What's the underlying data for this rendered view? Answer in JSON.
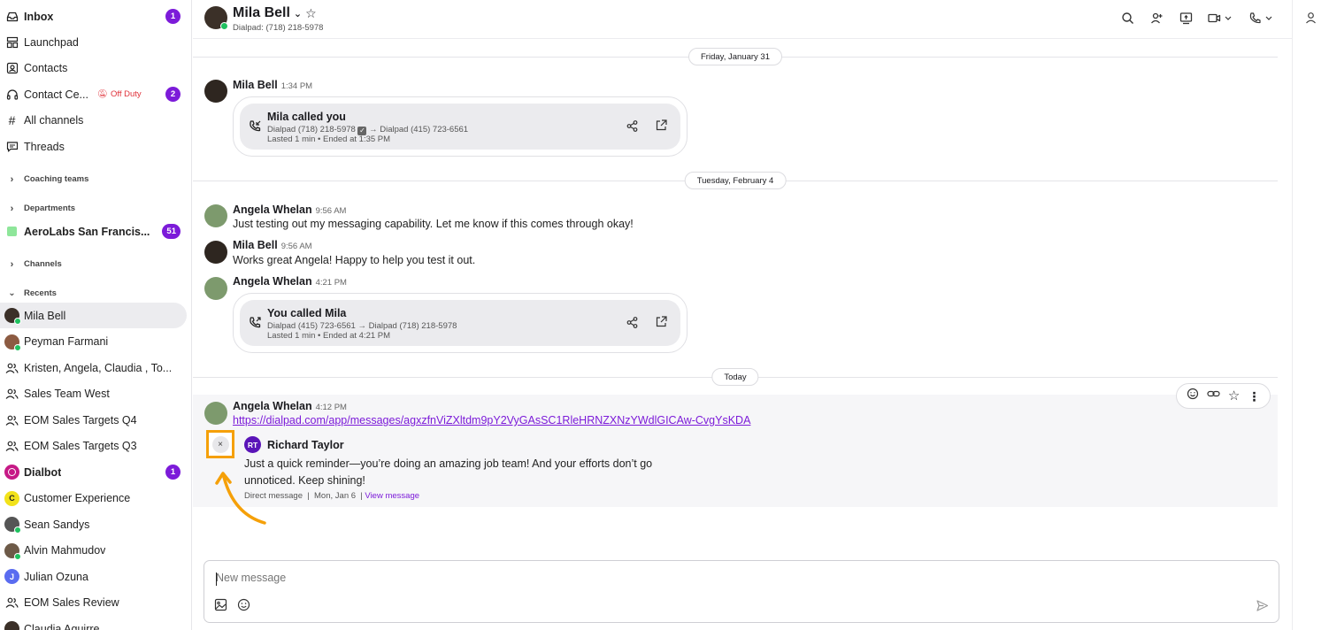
{
  "sidebar": {
    "inbox": {
      "label": "Inbox",
      "badge": "1"
    },
    "launchpad": "Launchpad",
    "contacts": "Contacts",
    "contact_center": {
      "label": "Contact Ce...",
      "status": "Off Duty",
      "badge": "2"
    },
    "all_channels": "All channels",
    "threads": "Threads",
    "coaching_teams": "Coaching teams",
    "departments": "Departments",
    "aerolabs": {
      "label": "AeroLabs San Francis...",
      "badge": "51"
    },
    "channels": "Channels",
    "recents": "Recents",
    "recent_items": [
      {
        "label": "Mila Bell",
        "type": "person",
        "online": true,
        "active": true
      },
      {
        "label": "Peyman Farmani",
        "type": "person",
        "online": true
      },
      {
        "label": "Kristen, Angela, Claudia , To...",
        "type": "group"
      },
      {
        "label": "Sales Team West",
        "type": "group"
      },
      {
        "label": "EOM Sales Targets Q4",
        "type": "group"
      },
      {
        "label": "EOM Sales Targets Q3",
        "type": "group"
      },
      {
        "label": "Dialbot",
        "type": "bot",
        "bold": true,
        "badge": "1"
      },
      {
        "label": "Customer Experience",
        "type": "letter",
        "letter": "C"
      },
      {
        "label": "Sean Sandys",
        "type": "person",
        "online": true
      },
      {
        "label": "Alvin Mahmudov",
        "type": "person",
        "online": true
      },
      {
        "label": "Julian Ozuna",
        "type": "letter",
        "letter": "J"
      },
      {
        "label": "EOM Sales Review",
        "type": "group"
      },
      {
        "label": "Claudia Aguirre",
        "type": "person"
      }
    ]
  },
  "header": {
    "name": "Mila Bell",
    "subtitle": "Dialpad: (718) 218-5978"
  },
  "chat": {
    "dates": [
      "Friday, January 31",
      "Tuesday, February 4",
      "Today"
    ],
    "msg1": {
      "author": "Mila Bell",
      "time": "1:34 PM",
      "call_title": "Mila called you",
      "call_from": "Dialpad (718) 218-5978",
      "call_to": "→ Dialpad (415) 723-6561",
      "call_meta": "Lasted 1 min • Ended at 1:35 PM"
    },
    "msg2": {
      "author": "Angela Whelan",
      "time": "9:56 AM",
      "text": "Just testing out my messaging capability. Let me know if this comes through okay!"
    },
    "msg3": {
      "author": "Mila Bell",
      "time": "9:56 AM",
      "text": "Works great Angela! Happy to help you test it out."
    },
    "msg4": {
      "author": "Angela Whelan",
      "time": "4:21 PM",
      "call_title": "You called Mila",
      "call_route": "Dialpad (415) 723-6561 → Dialpad (718) 218-5978",
      "call_meta": "Lasted 1 min • Ended at 4:21 PM"
    },
    "msg5": {
      "author": "Angela Whelan",
      "time": "4:12 PM",
      "link": "https://dialpad.com/app/messages/agxzfnViZXltdm9pY2VyGAsSC1RleHRNZXNzYWdlGICAw-CvgYsKDA",
      "quote_initials": "RT",
      "quote_author": "Richard Taylor",
      "quote_text": "Just a quick reminder—you’re doing an amazing job team! And your efforts don’t go unnoticed. Keep shining!",
      "quote_meta": "Direct message  |  Mon, Jan 6  |",
      "quote_link": "View message"
    },
    "close_glyph": "×"
  },
  "composer": {
    "placeholder": "New message"
  },
  "colors": {
    "accent": "#7c1bd9",
    "highlight": "#f5a009",
    "online": "#1fc15f",
    "off_duty": "#e0313a"
  }
}
